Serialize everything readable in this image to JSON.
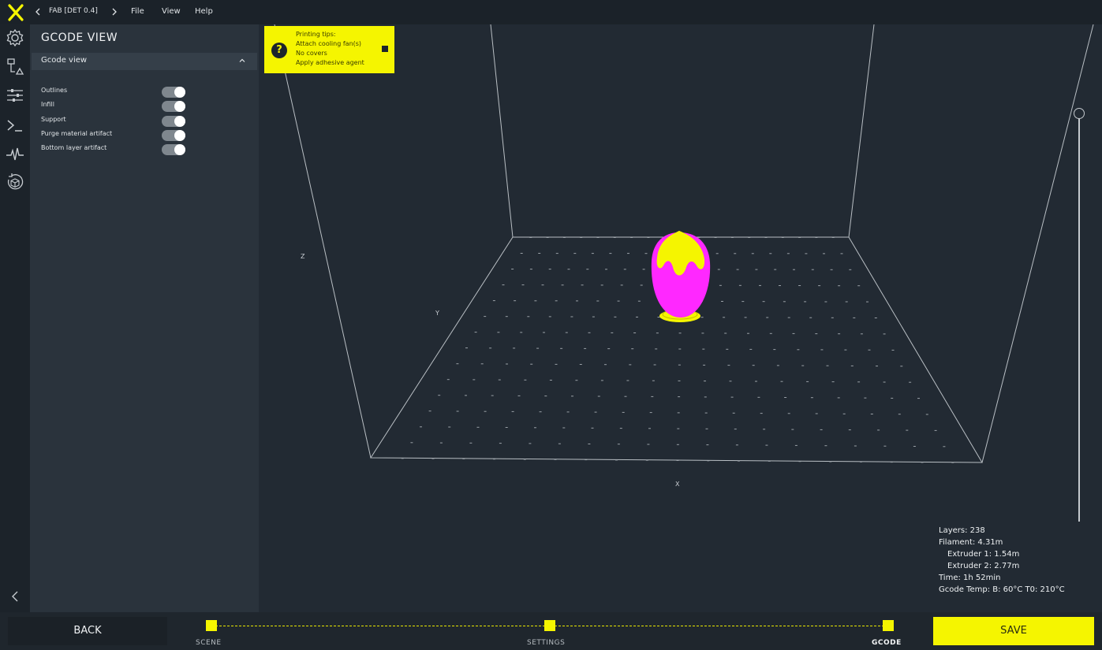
{
  "app": {
    "logo_icon": "x-logo-icon",
    "nav_back_icon": "chevron-left-icon",
    "project_label": "FAB [DET 0.4]",
    "nav_forward_icon": "chevron-right-icon",
    "menu": [
      "File",
      "View",
      "Help"
    ]
  },
  "iconbar": {
    "items": [
      "gear-icon",
      "nodes-icon",
      "sliders-icon",
      "terminal-icon",
      "pulse-icon",
      "rotate-cube-icon"
    ],
    "collapse_icon": "chevron-left-icon"
  },
  "panel": {
    "title": "GCODE VIEW",
    "section": {
      "label": "Gcode view",
      "expanded": true
    },
    "options": [
      {
        "label": "Outlines",
        "enabled": true
      },
      {
        "label": "Infill",
        "enabled": true
      },
      {
        "label": "Support",
        "enabled": true
      },
      {
        "label": "Purge material artifact",
        "enabled": true
      },
      {
        "label": "Bottom layer artifact",
        "enabled": true
      }
    ]
  },
  "tips": {
    "icon": "question-icon",
    "lines": [
      "Printing tips:",
      "Attach cooling fan(s)",
      "No covers",
      "Apply adhesive agent"
    ],
    "close_icon": "close-icon"
  },
  "viewport": {
    "axes": {
      "z": "Z",
      "y": "Y",
      "x": "X"
    },
    "layer_slider_fraction": 1.0,
    "colors": {
      "model_primary": "#f5f500",
      "model_secondary": "#ff28ff",
      "bed_grid": "#9aa1a7"
    }
  },
  "stats": {
    "layers": "Layers: 238",
    "filament": "Filament: 4.31m",
    "extruder1": "Extruder 1: 1.54m",
    "extruder2": "Extruder 2: 2.77m",
    "time": "Time: 1h 52min",
    "gcode_temp": "Gcode Temp: B: 60°C T0: 210°C"
  },
  "footer": {
    "back": "BACK",
    "save": "SAVE",
    "steps": [
      "SCENE",
      "SETTINGS",
      "GCODE"
    ],
    "active_step": "GCODE",
    "accent": "#f5f500"
  }
}
